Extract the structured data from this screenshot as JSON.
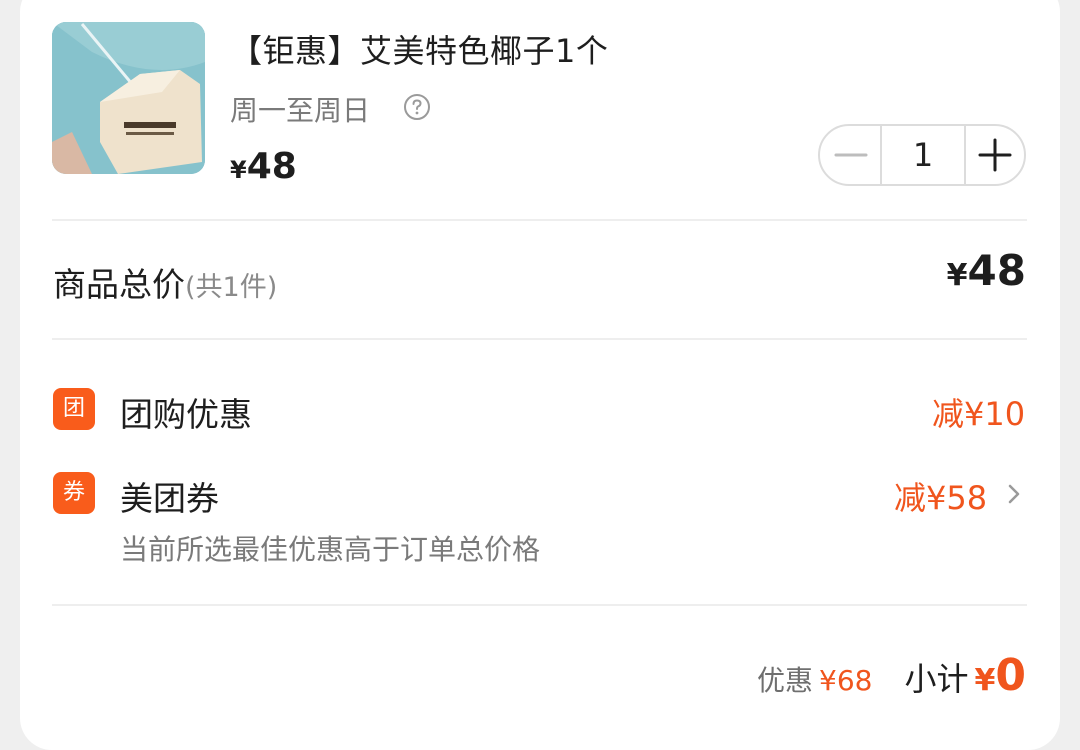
{
  "product": {
    "title": "【钜惠】艾美特色椰子1个",
    "schedule": "周一至周日",
    "price_currency": "¥",
    "price": "48",
    "quantity": "1"
  },
  "summary": {
    "label": "商品总价",
    "count_note": "(共1件)",
    "currency": "¥",
    "amount": "48"
  },
  "promotions": [
    {
      "badge": "团",
      "label": "团购优惠",
      "value": "减¥10"
    },
    {
      "badge": "券",
      "label": "美团券",
      "value": "减¥58",
      "note": "当前所选最佳优惠高于订单总价格"
    }
  ],
  "footer": {
    "discount_label": "优惠",
    "discount_value": "¥68",
    "subtotal_label": "小计",
    "subtotal_currency": "¥",
    "subtotal_value": "0"
  },
  "colors": {
    "accent": "#f0551d",
    "badge": "#f95c1b"
  },
  "icons": {
    "help": "question-circle-icon",
    "minus": "minus-icon",
    "plus": "plus-icon",
    "chevron": "chevron-right-icon"
  }
}
